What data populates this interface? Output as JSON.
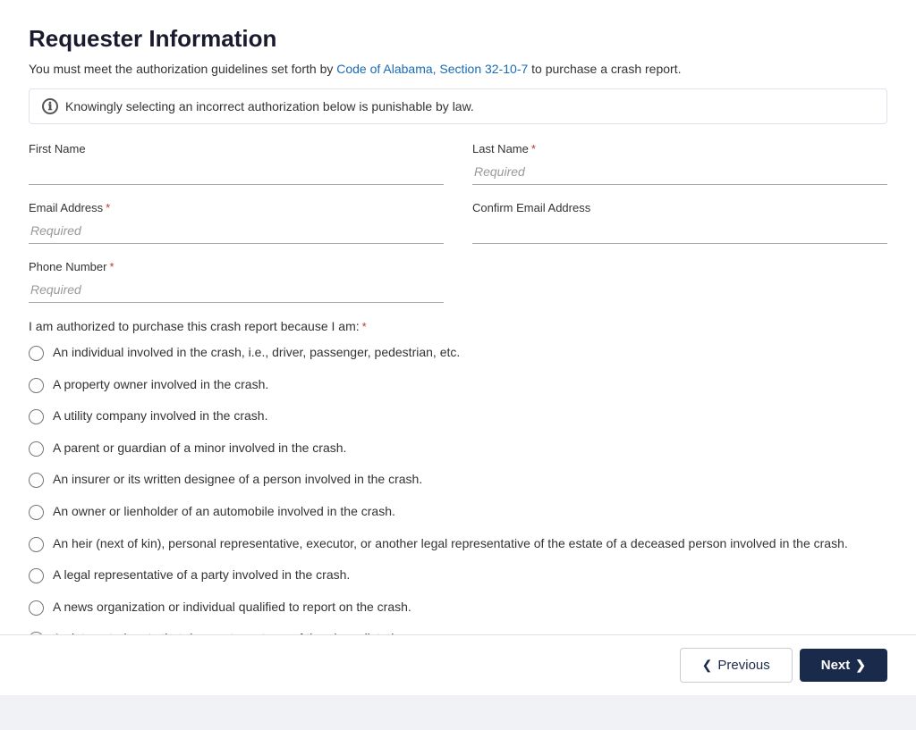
{
  "page": {
    "title": "Requester Information",
    "intro": {
      "text_before_link": "You must meet the authorization guidelines set forth by ",
      "link_text": "Code of Alabama, Section 32-10-7",
      "text_after_link": " to purchase a crash report."
    },
    "info_banner": {
      "icon": "ℹ",
      "text": "Knowingly selecting an incorrect authorization below is punishable by law."
    },
    "form": {
      "first_name_label": "First Name",
      "last_name_label": "Last Name",
      "last_name_placeholder": "Required",
      "email_label": "Email Address",
      "email_placeholder": "Required",
      "confirm_email_label": "Confirm Email Address",
      "confirm_email_placeholder": "",
      "phone_label": "Phone Number",
      "phone_placeholder": "Required",
      "authorization_label": "I am authorized to purchase this crash report because I am:",
      "radio_options": [
        "An individual involved in the crash, i.e., driver, passenger, pedestrian, etc.",
        "A property owner involved in the crash.",
        "A utility company involved in the crash.",
        "A parent or guardian of a minor involved in the crash.",
        "An insurer or its written designee of a person involved in the crash.",
        "An owner or lienholder of an automobile involved in the crash.",
        "An heir (next of kin), personal representative, executor, or another legal representative of the estate of a deceased person involved in the crash.",
        "A legal representative of a party involved in the crash.",
        "A news organization or individual qualified to report on the crash.",
        "An interested party that does not meet any of the above listed reasons."
      ]
    },
    "footer": {
      "previous_label": "Previous",
      "next_label": "Next",
      "previous_chevron": "❮",
      "next_chevron": "❯"
    }
  }
}
